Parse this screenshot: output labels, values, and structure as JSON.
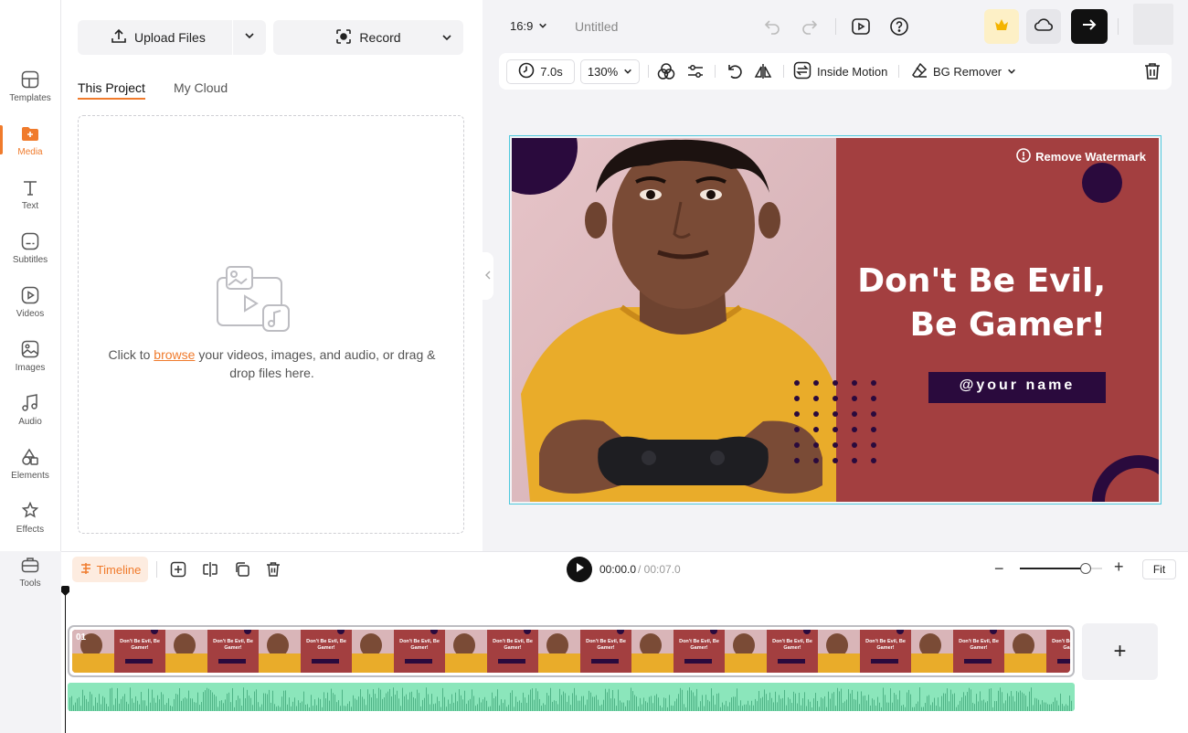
{
  "sidebar": {
    "items": [
      {
        "label": "Templates",
        "icon": "templates-icon"
      },
      {
        "label": "Media",
        "icon": "media-icon",
        "active": true
      },
      {
        "label": "Text",
        "icon": "text-icon"
      },
      {
        "label": "Subtitles",
        "icon": "subtitles-icon"
      },
      {
        "label": "Videos",
        "icon": "videos-icon"
      },
      {
        "label": "Images",
        "icon": "images-icon"
      },
      {
        "label": "Audio",
        "icon": "audio-icon"
      },
      {
        "label": "Elements",
        "icon": "elements-icon"
      },
      {
        "label": "Effects",
        "icon": "effects-icon"
      },
      {
        "label": "Tools",
        "icon": "tools-icon"
      }
    ]
  },
  "media_panel": {
    "upload_label": "Upload Files",
    "record_label": "Record",
    "tabs": [
      "This Project",
      "My Cloud"
    ],
    "drop_prefix": "Click to ",
    "drop_link": "browse",
    "drop_suffix": " your videos, images, and audio, or drag & drop files here."
  },
  "topbar": {
    "aspect_ratio": "16:9",
    "title": "Untitled"
  },
  "properties": {
    "duration": "7.0s",
    "zoom": "130%",
    "inside_motion": "Inside Motion",
    "bg_remover": "BG Remover"
  },
  "canvas": {
    "watermark": "Remove Watermark",
    "headline_1": "Don't Be Evil,",
    "headline_2": "Be Gamer!",
    "name_tag": "@your name"
  },
  "timeline": {
    "tab_label": "Timeline",
    "current_time": "00:00.0",
    "total_time": "/ 00:07.0",
    "fit_label": "Fit",
    "zoom_level": 0.8,
    "clip_number": "01",
    "thumbnail_headline": "Don't Be Evil, Be Gamer!"
  },
  "colors": {
    "accent": "#f07b2c",
    "canvas_red": "#a33f40",
    "dark_purple": "#2a0a3d",
    "selection": "#4fc9dd",
    "audio_green": "#8be6bb"
  }
}
